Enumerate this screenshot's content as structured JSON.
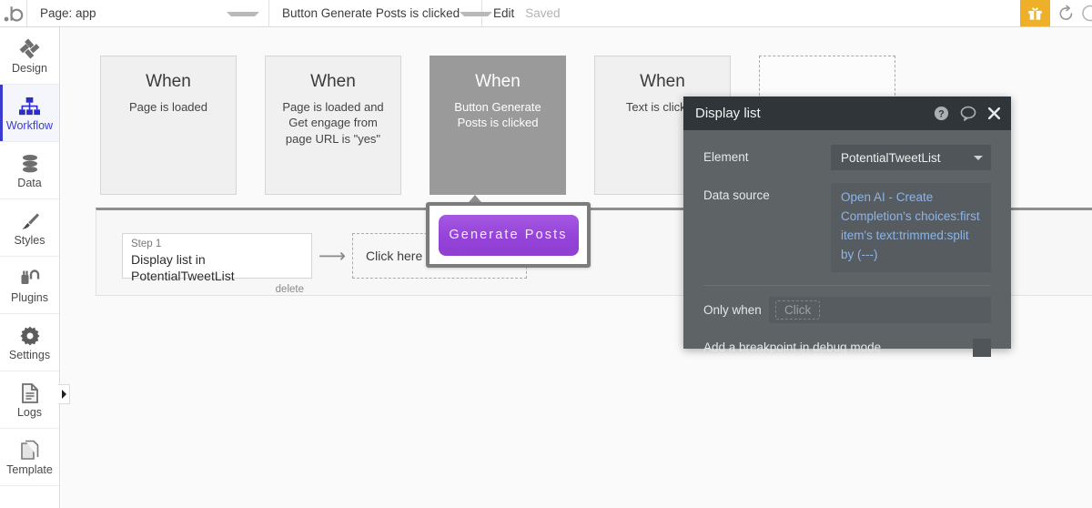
{
  "topbar": {
    "logo_icon": "bubble-logo",
    "page_selector": {
      "label": "Page: app",
      "caret_icon": "chevron-down-icon"
    },
    "event_selector": {
      "label": "Button Generate Posts is clicked",
      "caret_icon": "chevron-down-icon"
    },
    "edit_link": "Edit",
    "save_status": "Saved",
    "gift_icon": "gift-icon",
    "gift_bg": "#eeb028",
    "undo_icon": "undo-icon"
  },
  "sidebar": {
    "expand_icon": "chevron-right-icon",
    "items": [
      {
        "label": "Design",
        "icon": "design-icon",
        "active": false
      },
      {
        "label": "Workflow",
        "icon": "workflow-icon",
        "active": true
      },
      {
        "label": "Data",
        "icon": "database-icon",
        "active": false
      },
      {
        "label": "Styles",
        "icon": "brush-icon",
        "active": false
      },
      {
        "label": "Plugins",
        "icon": "plug-icon",
        "active": false
      },
      {
        "label": "Settings",
        "icon": "gear-icon",
        "active": false
      },
      {
        "label": "Logs",
        "icon": "logs-icon",
        "active": false
      },
      {
        "label": "Template",
        "icon": "template-icon",
        "active": false
      }
    ],
    "active_color": "#3b3bd4"
  },
  "canvas": {
    "events": [
      {
        "when": "When",
        "desc": "Page is loaded",
        "selected": false
      },
      {
        "when": "When",
        "desc": "Page is loaded and Get engage from page URL is \"yes\"",
        "selected": false
      },
      {
        "when": "When",
        "desc": "Button Generate Posts is clicked",
        "selected": true
      },
      {
        "when": "When",
        "desc": "Text is clicked",
        "selected": false
      }
    ],
    "add_event_placeholder": ""
  },
  "action_panel": {
    "step": {
      "number_label": "Step 1",
      "title": "Display list in PotentialTweetList",
      "delete_label": "delete"
    },
    "arrow_icon": "arrow-right-icon",
    "add_action_label": "Click here to add an action..."
  },
  "floating_button": {
    "label": "Generate Posts",
    "color_start": "#a559e2",
    "color_end": "#8f3fd2"
  },
  "dialog": {
    "title": "Display list",
    "help_icon": "help-circle-icon",
    "comment_icon": "comment-icon",
    "close_icon": "close-icon",
    "element": {
      "label": "Element",
      "value": "PotentialTweetList",
      "caret_icon": "chevron-down-icon"
    },
    "data_source": {
      "label": "Data source",
      "value": "Open AI - Create Completion's choices:first item's text:trimmed:split by (---)",
      "value_color": "#8cb4e8"
    },
    "only_when": {
      "label": "Only when",
      "placeholder": "Click"
    },
    "breakpoint": {
      "label": "Add a breakpoint in debug mode",
      "checked": false
    }
  }
}
